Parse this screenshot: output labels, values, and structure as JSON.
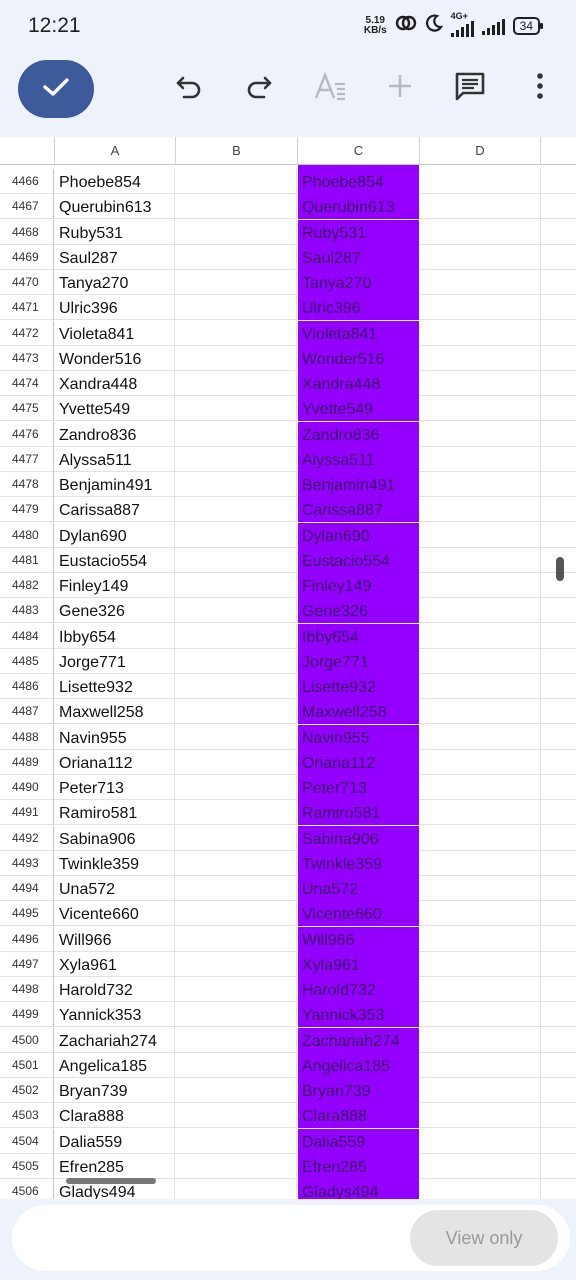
{
  "status": {
    "time": "12:21",
    "net_speed_value": "5.19",
    "net_speed_unit": "KB/s",
    "network_type": "4G+",
    "battery": "34"
  },
  "toolbar": {
    "accent": "#3d5b9b"
  },
  "columns": [
    "A",
    "B",
    "C",
    "D"
  ],
  "highlight_color": "#9400ff",
  "rows": [
    {
      "n": "4466",
      "a": "Phoebe854",
      "c": "Phoebe854"
    },
    {
      "n": "4467",
      "a": "Querubin613",
      "c": "Querubin613"
    },
    {
      "n": "4468",
      "a": "Ruby531",
      "c": "Ruby531"
    },
    {
      "n": "4469",
      "a": "Saul287",
      "c": "Saul287"
    },
    {
      "n": "4470",
      "a": "Tanya270",
      "c": "Tanya270"
    },
    {
      "n": "4471",
      "a": "Ulric396",
      "c": "Ulric396"
    },
    {
      "n": "4472",
      "a": "Violeta841",
      "c": "Violeta841"
    },
    {
      "n": "4473",
      "a": "Wonder516",
      "c": "Wonder516"
    },
    {
      "n": "4474",
      "a": "Xandra448",
      "c": "Xandra448"
    },
    {
      "n": "4475",
      "a": "Yvette549",
      "c": "Yvette549"
    },
    {
      "n": "4476",
      "a": "Zandro836",
      "c": "Zandro836"
    },
    {
      "n": "4477",
      "a": "Alyssa511",
      "c": "Alyssa511"
    },
    {
      "n": "4478",
      "a": "Benjamin491",
      "c": "Benjamin491"
    },
    {
      "n": "4479",
      "a": "Carissa887",
      "c": "Carissa887"
    },
    {
      "n": "4480",
      "a": "Dylan690",
      "c": "Dylan690"
    },
    {
      "n": "4481",
      "a": "Eustacio554",
      "c": "Eustacio554"
    },
    {
      "n": "4482",
      "a": "Finley149",
      "c": "Finley149"
    },
    {
      "n": "4483",
      "a": "Gene326",
      "c": "Gene326"
    },
    {
      "n": "4484",
      "a": "Ibby654",
      "c": "Ibby654"
    },
    {
      "n": "4485",
      "a": "Jorge771",
      "c": "Jorge771"
    },
    {
      "n": "4486",
      "a": "Lisette932",
      "c": "Lisette932"
    },
    {
      "n": "4487",
      "a": "Maxwell258",
      "c": "Maxwell258"
    },
    {
      "n": "4488",
      "a": "Navin955",
      "c": "Navin955"
    },
    {
      "n": "4489",
      "a": "Oriana112",
      "c": "Oriana112"
    },
    {
      "n": "4490",
      "a": "Peter713",
      "c": "Peter713"
    },
    {
      "n": "4491",
      "a": "Ramiro581",
      "c": "Ramiro581"
    },
    {
      "n": "4492",
      "a": "Sabina906",
      "c": "Sabina906"
    },
    {
      "n": "4493",
      "a": "Twinkle359",
      "c": "Twinkle359"
    },
    {
      "n": "4494",
      "a": "Una572",
      "c": "Una572"
    },
    {
      "n": "4495",
      "a": "Vicente660",
      "c": "Vicente660"
    },
    {
      "n": "4496",
      "a": "Will966",
      "c": "Will966"
    },
    {
      "n": "4497",
      "a": "Xyla961",
      "c": "Xyla961"
    },
    {
      "n": "4498",
      "a": "Harold732",
      "c": "Harold732"
    },
    {
      "n": "4499",
      "a": "Yannick353",
      "c": "Yannick353"
    },
    {
      "n": "4500",
      "a": "Zachariah274",
      "c": "Zachariah274"
    },
    {
      "n": "4501",
      "a": "Angelica185",
      "c": "Angelica185"
    },
    {
      "n": "4502",
      "a": "Bryan739",
      "c": "Bryan739"
    },
    {
      "n": "4503",
      "a": "Clara888",
      "c": "Clara888"
    },
    {
      "n": "4504",
      "a": "Dalia559",
      "c": "Dalia559"
    },
    {
      "n": "4505",
      "a": "Efren285",
      "c": "Efren285"
    },
    {
      "n": "4506",
      "a": "Gladys494",
      "c": "Gladys494"
    }
  ],
  "footer": {
    "view_only_label": "View only"
  }
}
